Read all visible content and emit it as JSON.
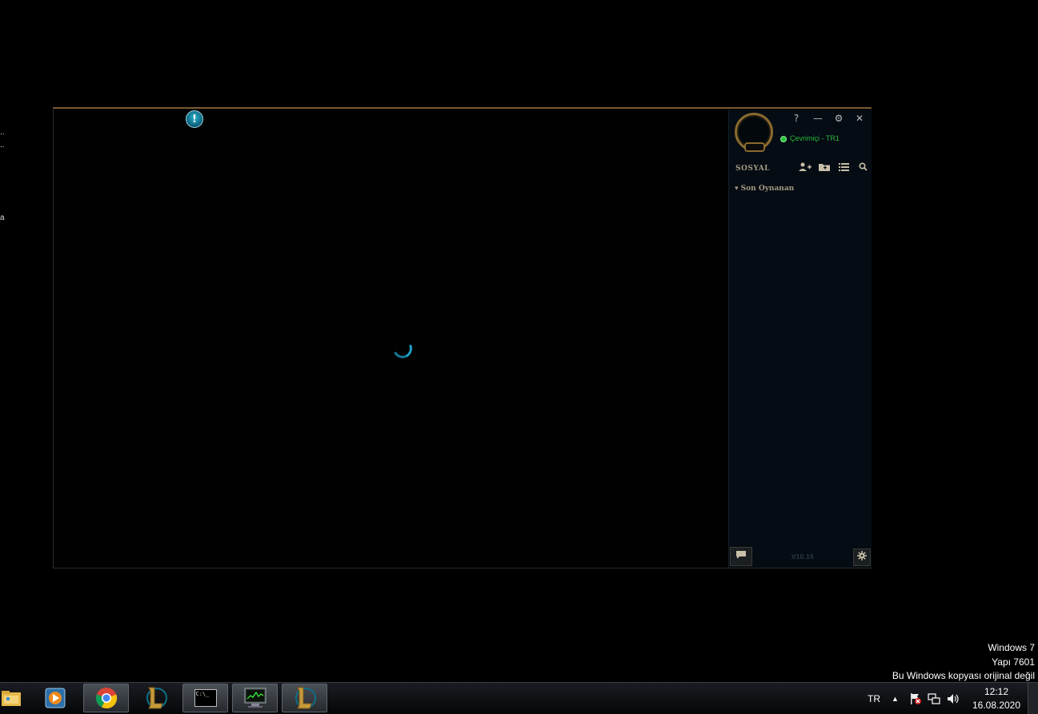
{
  "desktop": {
    "fragments": [
      "..",
      "..",
      "a"
    ]
  },
  "client": {
    "alert_glyph": "!",
    "social": {
      "window_buttons": {
        "help": "?",
        "minimize": "—",
        "settings": "⚙",
        "close": "✕"
      },
      "status_text": "Çevrimiçi - TR1",
      "title": "SOSYAL",
      "section": "Son Oynanan",
      "section_arrow": "▾",
      "version": "V10.16"
    }
  },
  "watermark": {
    "line1": "Windows 7",
    "line2": "Yapı 7601",
    "line3": "Bu Windows kopyası orijinal değil"
  },
  "taskbar": {
    "language": "TR",
    "time": "12:12",
    "date": "16.08.2020",
    "apps": [
      "explorer-icon",
      "media-player-icon",
      "chrome-icon",
      "league-client-icon",
      "cmd-icon",
      "task-manager-icon",
      "league-client-icon"
    ],
    "cmd_text": "C:\\_"
  }
}
